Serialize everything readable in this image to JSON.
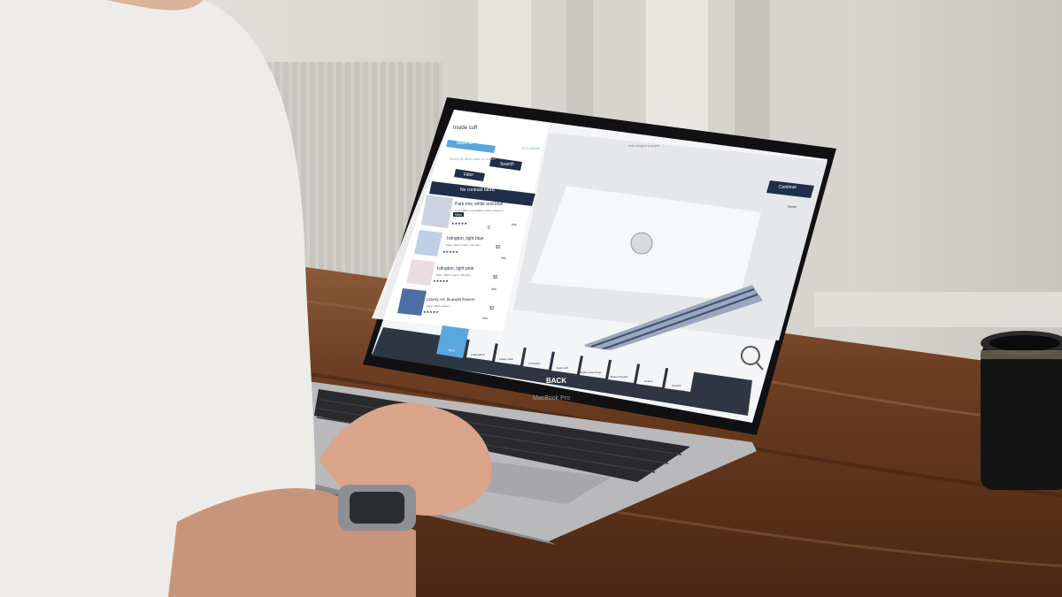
{
  "screen": {
    "left_panel": {
      "header": "Inside cuff",
      "tabs": [
        "Material",
        "EC3 000ml"
      ],
      "search_placeholder": "Search by fabric name or number",
      "search_button": "Search",
      "filter_button": "Filter",
      "active_filter": "No contrast fabric",
      "fabrics": [
        {
          "name": "Park row, white and blue",
          "desc": "Ocd, 100% Long Staple Cotton, 110 g/m²",
          "badge": "New",
          "stars": "★★★★★",
          "price": "0",
          "info": "Info"
        },
        {
          "name": "Islington, light blue",
          "desc": "Plain, 100% Cotton, 115 g/m²",
          "stars": "★★★★★",
          "price": "$5",
          "info": "Info"
        },
        {
          "name": "Islington, light pink",
          "desc": "Plain, 100% Cotton, 115 g/m²",
          "stars": "★★★★★",
          "price": "$5",
          "info": "Info"
        },
        {
          "name": "Liberty Art, bluewild flowers",
          "desc": "Plain, 100% Cotton",
          "stars": "★★★★★",
          "price": "$3",
          "info": "Info"
        }
      ]
    },
    "url": "shirt-designer.example",
    "continue_button": "Continue",
    "reset_button": "Reset",
    "back_button": "BACK",
    "toolbar_items": [
      "Back",
      "Collar fabric",
      "Inside collar",
      "Cuff fabric",
      "Inside cuff",
      "Button fastenings",
      "Button threads",
      "Collars",
      "Pockets",
      "Monogramming"
    ]
  },
  "laptop_label": "MacBook Pro",
  "colors": {
    "ui_navy": "#1f2f4a",
    "ui_accent": "#5aa7e0",
    "desk": "#6b3d22",
    "shirt": "#f1efec"
  }
}
